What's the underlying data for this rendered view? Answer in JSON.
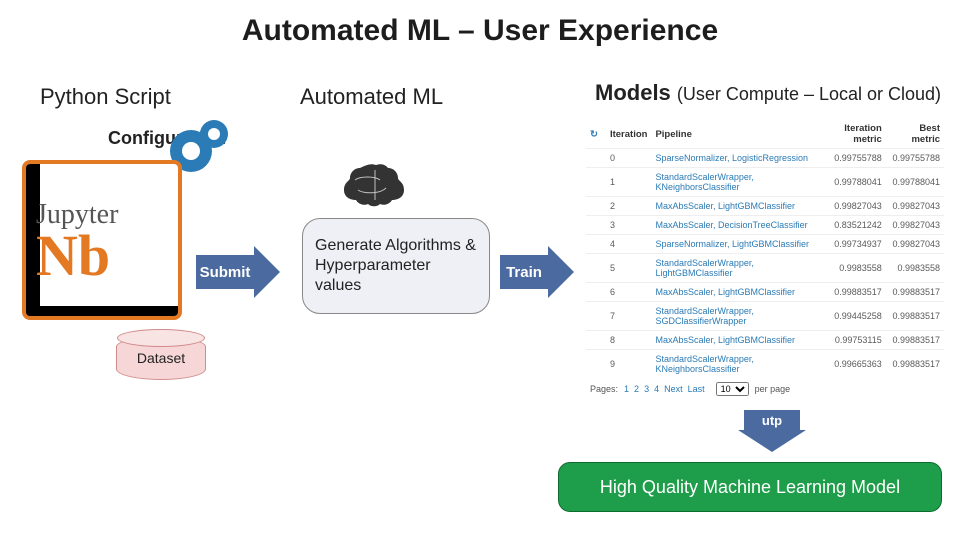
{
  "title": "Automated ML – User Experience",
  "columns": {
    "python": "Python Script",
    "automl": "Automated ML",
    "models": "Models",
    "models_sub": "(User Compute – Local or Cloud)"
  },
  "labels": {
    "configuration": "Configuration",
    "dataset": "Dataset",
    "submit": "Submit",
    "train": "Train",
    "output": "utp",
    "jupyter_top": "Jupyter",
    "jupyter_nb": "Nb"
  },
  "automl_box": "Generate Algorithms & Hyperparameter values",
  "output_box": "High Quality Machine Learning Model",
  "table": {
    "headers": {
      "iter": "Iteration",
      "pipe": "Pipeline",
      "imetric": "Iteration metric",
      "best": "Best metric"
    },
    "rows": [
      {
        "iter": 0,
        "pipe": "SparseNormalizer, LogisticRegression",
        "imetric": "0.99755788",
        "best": "0.99755788"
      },
      {
        "iter": 1,
        "pipe": "StandardScalerWrapper, KNeighborsClassifier",
        "imetric": "0.99788041",
        "best": "0.99788041"
      },
      {
        "iter": 2,
        "pipe": "MaxAbsScaler, LightGBMClassifier",
        "imetric": "0.99827043",
        "best": "0.99827043"
      },
      {
        "iter": 3,
        "pipe": "MaxAbsScaler, DecisionTreeClassifier",
        "imetric": "0.83521242",
        "best": "0.99827043"
      },
      {
        "iter": 4,
        "pipe": "SparseNormalizer, LightGBMClassifier",
        "imetric": "0.99734937",
        "best": "0.99827043"
      },
      {
        "iter": 5,
        "pipe": "StandardScalerWrapper, LightGBMClassifier",
        "imetric": "0.9983558",
        "best": "0.9983558"
      },
      {
        "iter": 6,
        "pipe": "MaxAbsScaler, LightGBMClassifier",
        "imetric": "0.99883517",
        "best": "0.99883517"
      },
      {
        "iter": 7,
        "pipe": "StandardScalerWrapper, SGDClassifierWrapper",
        "imetric": "0.99445258",
        "best": "0.99883517"
      },
      {
        "iter": 8,
        "pipe": "MaxAbsScaler, LightGBMClassifier",
        "imetric": "0.99753115",
        "best": "0.99883517"
      },
      {
        "iter": 9,
        "pipe": "StandardScalerWrapper, KNeighborsClassifier",
        "imetric": "0.99665363",
        "best": "0.99883517"
      }
    ],
    "pager": {
      "label": "Pages:",
      "pages": [
        "1",
        "2",
        "3",
        "4",
        "Next",
        "Last"
      ],
      "perpage": "10",
      "perpage_suffix": "per page"
    }
  }
}
